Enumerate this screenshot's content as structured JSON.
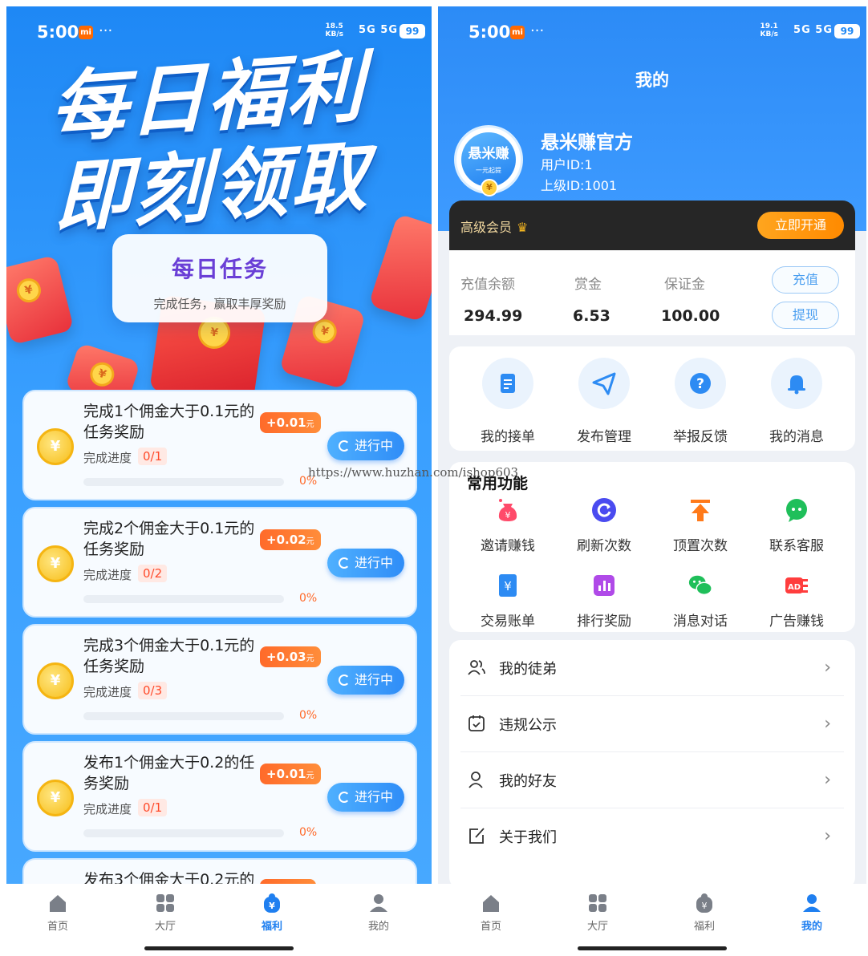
{
  "status_left": {
    "time": "5:00",
    "net": "18.5",
    "net2": "KB/s",
    "sig": "5G  5G",
    "battery": "99"
  },
  "status_right": {
    "time": "5:00",
    "net": "19.1",
    "net2": "KB/s",
    "sig": "5G  5G",
    "battery": "99"
  },
  "left": {
    "hero_line1": "每日福利",
    "hero_line2": "即刻领取",
    "card_title": "每日任务",
    "card_subtitle": "完成任务，赢取丰厚奖励",
    "tasks": [
      {
        "title": "完成1个佣金大于0.1元的任务奖励",
        "reward": "+0.01",
        "reward_unit": "元",
        "progress_label": "完成进度",
        "progress": "0/1",
        "percent": "0%",
        "button": "进行中"
      },
      {
        "title": "完成2个佣金大于0.1元的任务奖励",
        "reward": "+0.02",
        "reward_unit": "元",
        "progress_label": "完成进度",
        "progress": "0/2",
        "percent": "0%",
        "button": "进行中"
      },
      {
        "title": "完成3个佣金大于0.1元的任务奖励",
        "reward": "+0.03",
        "reward_unit": "元",
        "progress_label": "完成进度",
        "progress": "0/3",
        "percent": "0%",
        "button": "进行中"
      },
      {
        "title": "发布1个佣金大于0.2的任务奖励",
        "reward": "+0.01",
        "reward_unit": "元",
        "progress_label": "完成进度",
        "progress": "0/1",
        "percent": "0%",
        "button": "进行中"
      }
    ],
    "partial_task_title": "发布3个佣金大于0.2元的",
    "watermark": "https://www.huzhan.com/ishop603"
  },
  "tabs": [
    {
      "label": "首页",
      "icon": "home-icon"
    },
    {
      "label": "大厅",
      "icon": "grid-icon"
    },
    {
      "label": "福利",
      "icon": "welfare-icon"
    },
    {
      "label": "我的",
      "icon": "user-icon"
    }
  ],
  "right": {
    "title": "我的",
    "avatar_text": "悬米赚",
    "avatar_sub": "一元起提",
    "username": "悬米赚官方",
    "user_id": "用户ID:1",
    "parent_id": "上级ID:1001",
    "vip_label": "高级会员",
    "vip_button": "立即开通",
    "balances": [
      {
        "label": "充值余额",
        "value": "294.99"
      },
      {
        "label": "赏金",
        "value": "6.53"
      },
      {
        "label": "保证金",
        "value": "100.00"
      }
    ],
    "recharge_button": "充值",
    "withdraw_button": "提现",
    "quick": [
      {
        "label": "我的接单",
        "icon": "document-icon"
      },
      {
        "label": "发布管理",
        "icon": "send-icon"
      },
      {
        "label": "举报反馈",
        "icon": "question-icon"
      },
      {
        "label": "我的消息",
        "icon": "bell-icon"
      }
    ],
    "common_title": "常用功能",
    "common": [
      {
        "label": "邀请赚钱",
        "icon": "money-bag-icon"
      },
      {
        "label": "刷新次数",
        "icon": "refresh-icon"
      },
      {
        "label": "顶置次数",
        "icon": "pin-top-icon"
      },
      {
        "label": "联系客服",
        "icon": "chat-icon"
      },
      {
        "label": "交易账单",
        "icon": "bill-icon"
      },
      {
        "label": "排行奖励",
        "icon": "rank-icon"
      },
      {
        "label": "消息对话",
        "icon": "wechat-icon"
      },
      {
        "label": "广告赚钱",
        "icon": "ad-icon"
      }
    ],
    "menu": [
      {
        "label": "我的徒弟",
        "icon": "users-icon"
      },
      {
        "label": "违规公示",
        "icon": "calendar-icon"
      },
      {
        "label": "我的好友",
        "icon": "friend-icon"
      },
      {
        "label": "关于我们",
        "icon": "edit-icon"
      }
    ]
  },
  "colors": {
    "primary": "#2c8bf6",
    "accent": "#ff6a2a",
    "vip_bg": "#262626",
    "vip_button": "#ff8a00"
  }
}
